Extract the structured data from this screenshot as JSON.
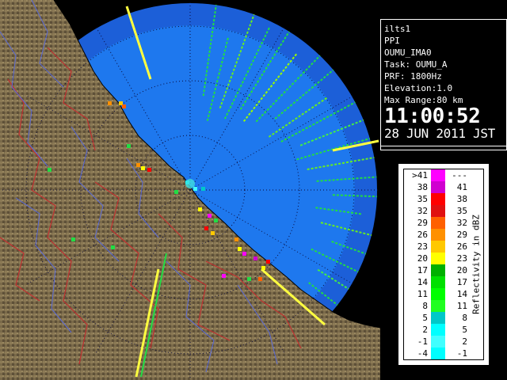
{
  "info": {
    "station": "ilts1",
    "scan_mode": "PPI",
    "site": "OUMU_IMA0",
    "task": "Task: OUMU_A",
    "prf": "PRF: 1800Hz",
    "elevation": "Elevation:1.0",
    "max_range": "Max Range:80 km",
    "time": "11:00:52",
    "date": "28 JUN 2011 JST"
  },
  "legend": {
    "caption": "Reflectivity in dBZ",
    "rows": [
      {
        "low": ">41",
        "high": "---",
        "color": "#ff00ff"
      },
      {
        "low": "38",
        "high": "41",
        "color": "#d000d0"
      },
      {
        "low": "35",
        "high": "38",
        "color": "#ff0000"
      },
      {
        "low": "32",
        "high": "35",
        "color": "#e01010"
      },
      {
        "low": "29",
        "high": "32",
        "color": "#ff6000"
      },
      {
        "low": "26",
        "high": "29",
        "color": "#ff9000"
      },
      {
        "low": "23",
        "high": "26",
        "color": "#ffc800"
      },
      {
        "low": "20",
        "high": "23",
        "color": "#ffff00"
      },
      {
        "low": "17",
        "high": "20",
        "color": "#00b000"
      },
      {
        "low": "14",
        "high": "17",
        "color": "#00e000"
      },
      {
        "low": "11",
        "high": "14",
        "color": "#00ff00"
      },
      {
        "low": "8",
        "high": "11",
        "color": "#20ff20"
      },
      {
        "low": "5",
        "high": "8",
        "color": "#00c8c8"
      },
      {
        "low": "2",
        "high": "5",
        "color": "#00ffff"
      },
      {
        "low": "-1",
        "high": "2",
        "color": "#40ffff"
      },
      {
        "low": "-4",
        "high": "-1",
        "color": "#00ffff"
      }
    ]
  },
  "colors": {
    "sea_inner": "#1e78ee",
    "sea_outer": "#1c5fd8",
    "land": "#7a6a4a",
    "border_red": "#c03030",
    "river_blue": "#5a6ad8",
    "echo_green": "#22dd44",
    "echo_yellow": "#ffff00"
  },
  "radar": {
    "range_ring_style": "dotted",
    "spoke_directions": "every 30 degrees"
  }
}
